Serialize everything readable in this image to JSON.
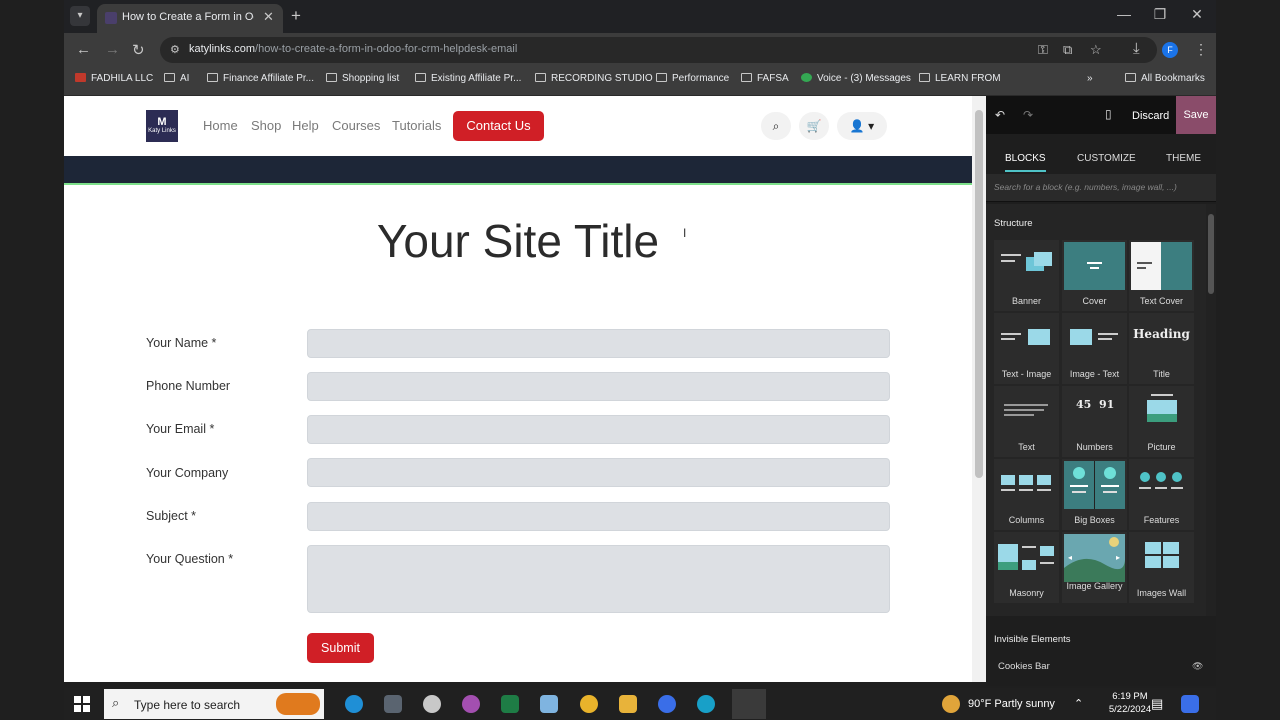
{
  "browser": {
    "tab_title": "How to Create a Form in Odoo",
    "url_host": "katylinks.com",
    "url_path": "/how-to-create-a-form-in-odoo-for-crm-helpdesk-email",
    "profile_initial": "F",
    "bookmarks": [
      "FADHILA LLC",
      "AI",
      "Finance Affiliate Pr...",
      "Shopping list",
      "Existing Affiliate Pr...",
      "RECORDING STUDIO",
      "Performance",
      "FAFSA",
      "Voice - (3) Messages",
      "LEARN FROM"
    ],
    "all_bookmarks": "All Bookmarks"
  },
  "site": {
    "logo_text": "Katy Links",
    "nav": [
      "Home",
      "Shop",
      "Help",
      "Courses",
      "Tutorials"
    ],
    "contact_button": "Contact Us",
    "title": "Your Site Title",
    "form": {
      "fields": [
        {
          "label": "Your Name *"
        },
        {
          "label": "Phone Number"
        },
        {
          "label": "Your Email *"
        },
        {
          "label": "Your Company"
        },
        {
          "label": "Subject *"
        },
        {
          "label": "Your Question *"
        }
      ],
      "submit": "Submit"
    }
  },
  "editor": {
    "discard": "Discard",
    "save": "Save",
    "tabs": [
      "BLOCKS",
      "CUSTOMIZE",
      "THEME"
    ],
    "active_tab": "BLOCKS",
    "search_placeholder": "Search for a block (e.g. numbers, image wall, ...)",
    "section_structure": "Structure",
    "snippets": [
      "Banner",
      "Cover",
      "Text Cover",
      "Text - Image",
      "Image - Text",
      "Title",
      "Text",
      "Numbers",
      "Picture",
      "Columns",
      "Big Boxes",
      "Features",
      "Masonry",
      "Image Gallery",
      "Images Wall"
    ],
    "heading_thumb": "Heading",
    "numbers_thumb": [
      "45",
      "91"
    ],
    "section_invisible": "Invisible Elements",
    "cookies_bar": "Cookies Bar"
  },
  "taskbar": {
    "search_placeholder": "Type here to search",
    "weather": "90°F  Partly sunny",
    "time": "6:19 PM",
    "date": "5/22/2024"
  },
  "colors": {
    "accent_red": "#d01f26",
    "save_purple": "#8a4c6a",
    "teal": "#3c7e80"
  }
}
